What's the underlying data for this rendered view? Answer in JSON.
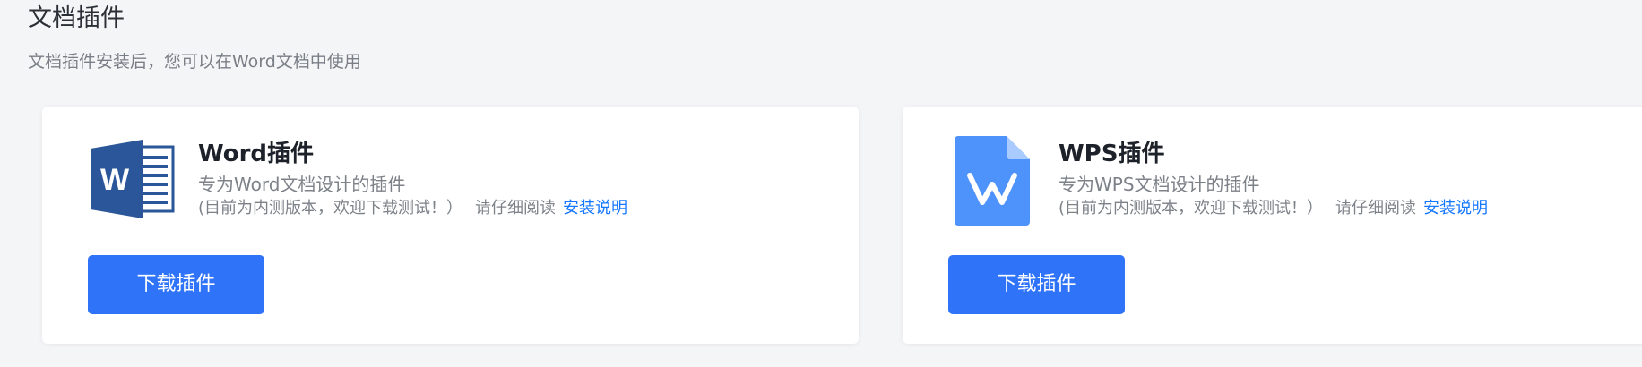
{
  "header": {
    "title": "文档插件",
    "subtitle": "文档插件安装后，您可以在Word文档中使用"
  },
  "plugins": [
    {
      "icon": "word-icon",
      "name": "Word插件",
      "description": "专为Word文档设计的插件",
      "note": "(目前为内测版本，欢迎下载测试！）",
      "read_label": "请仔细阅读",
      "install_link": "安装说明",
      "button_label": "下载插件"
    },
    {
      "icon": "wps-icon",
      "name": "WPS插件",
      "description": "专为WPS文档设计的插件",
      "note": "(目前为内测版本，欢迎下载测试！）",
      "read_label": "请仔细阅读",
      "install_link": "安装说明",
      "button_label": "下载插件"
    }
  ],
  "colors": {
    "accent": "#2f73f8",
    "link": "#1677ff",
    "word_blue": "#2b579a",
    "wps_blue": "#4e93fb"
  }
}
